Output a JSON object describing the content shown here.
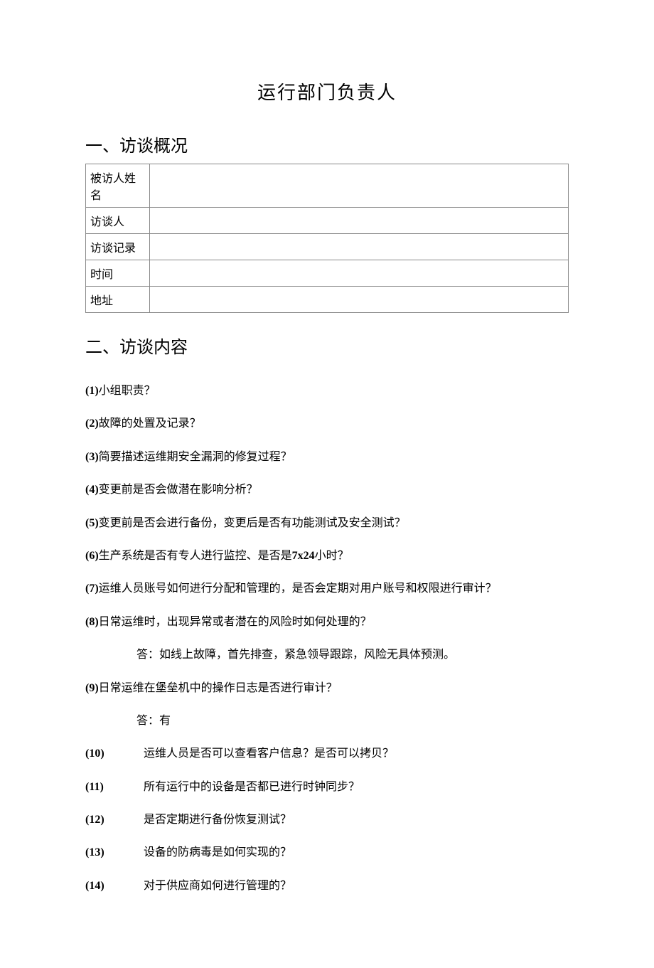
{
  "title": "运行部门负责人",
  "section1_heading": "一、访谈概况",
  "section2_heading": "二、访谈内容",
  "table": {
    "row1_label": "被访人姓名",
    "row1_value": "",
    "row2_label": "访谈人",
    "row2_value": "",
    "row3_label": "访谈记录",
    "row3_value": "",
    "row4_label": "时间",
    "row4_value": "",
    "row5_label": "地址",
    "row5_value": ""
  },
  "questions": {
    "q1_num": "(1)",
    "q1_text": "小组职责？",
    "q2_num": "(2)",
    "q2_text": "故障的处置及记录？",
    "q3_num": "(3)",
    "q3_text": "简要描述运维期安全漏洞的修复过程？",
    "q4_num": "(4)",
    "q4_text": "变更前是否会做潜在影响分析？",
    "q5_num": "(5)",
    "q5_text": "变更前是否会进行备份，变更后是否有功能测试及安全测试？",
    "q6_num": "(6)",
    "q6_text_a": "生产系统是否有专人进行监控、是否是",
    "q6_text_b": "7x24",
    "q6_text_c": "小时？",
    "q7_num": "(7)",
    "q7_text": "运维人员账号如何进行分配和管理的，是否会定期对用户账号和权限进行审计？",
    "q8_num": "(8)",
    "q8_text": "日常运维时，出现异常或者潜在的风险时如何处理的？",
    "q8_answer": "答：如线上故障，首先排查，紧急领导跟踪，风险无具体预测。",
    "q9_num": "(9)",
    "q9_text": "日常运维在堡垒机中的操作日志是否进行审计？",
    "q9_answer": "答：有",
    "q10_num": "(10)",
    "q10_text": "运维人员是否可以查看客户信息？是否可以拷贝？",
    "q11_num": "(11)",
    "q11_text": "所有运行中的设备是否都已进行时钟同步？",
    "q12_num": "(12)",
    "q12_text": "是否定期进行备份恢复测试？",
    "q13_num": "(13)",
    "q13_text": "设备的防病毒是如何实现的？",
    "q14_num": "(14)",
    "q14_text": "对于供应商如何进行管理的？"
  }
}
